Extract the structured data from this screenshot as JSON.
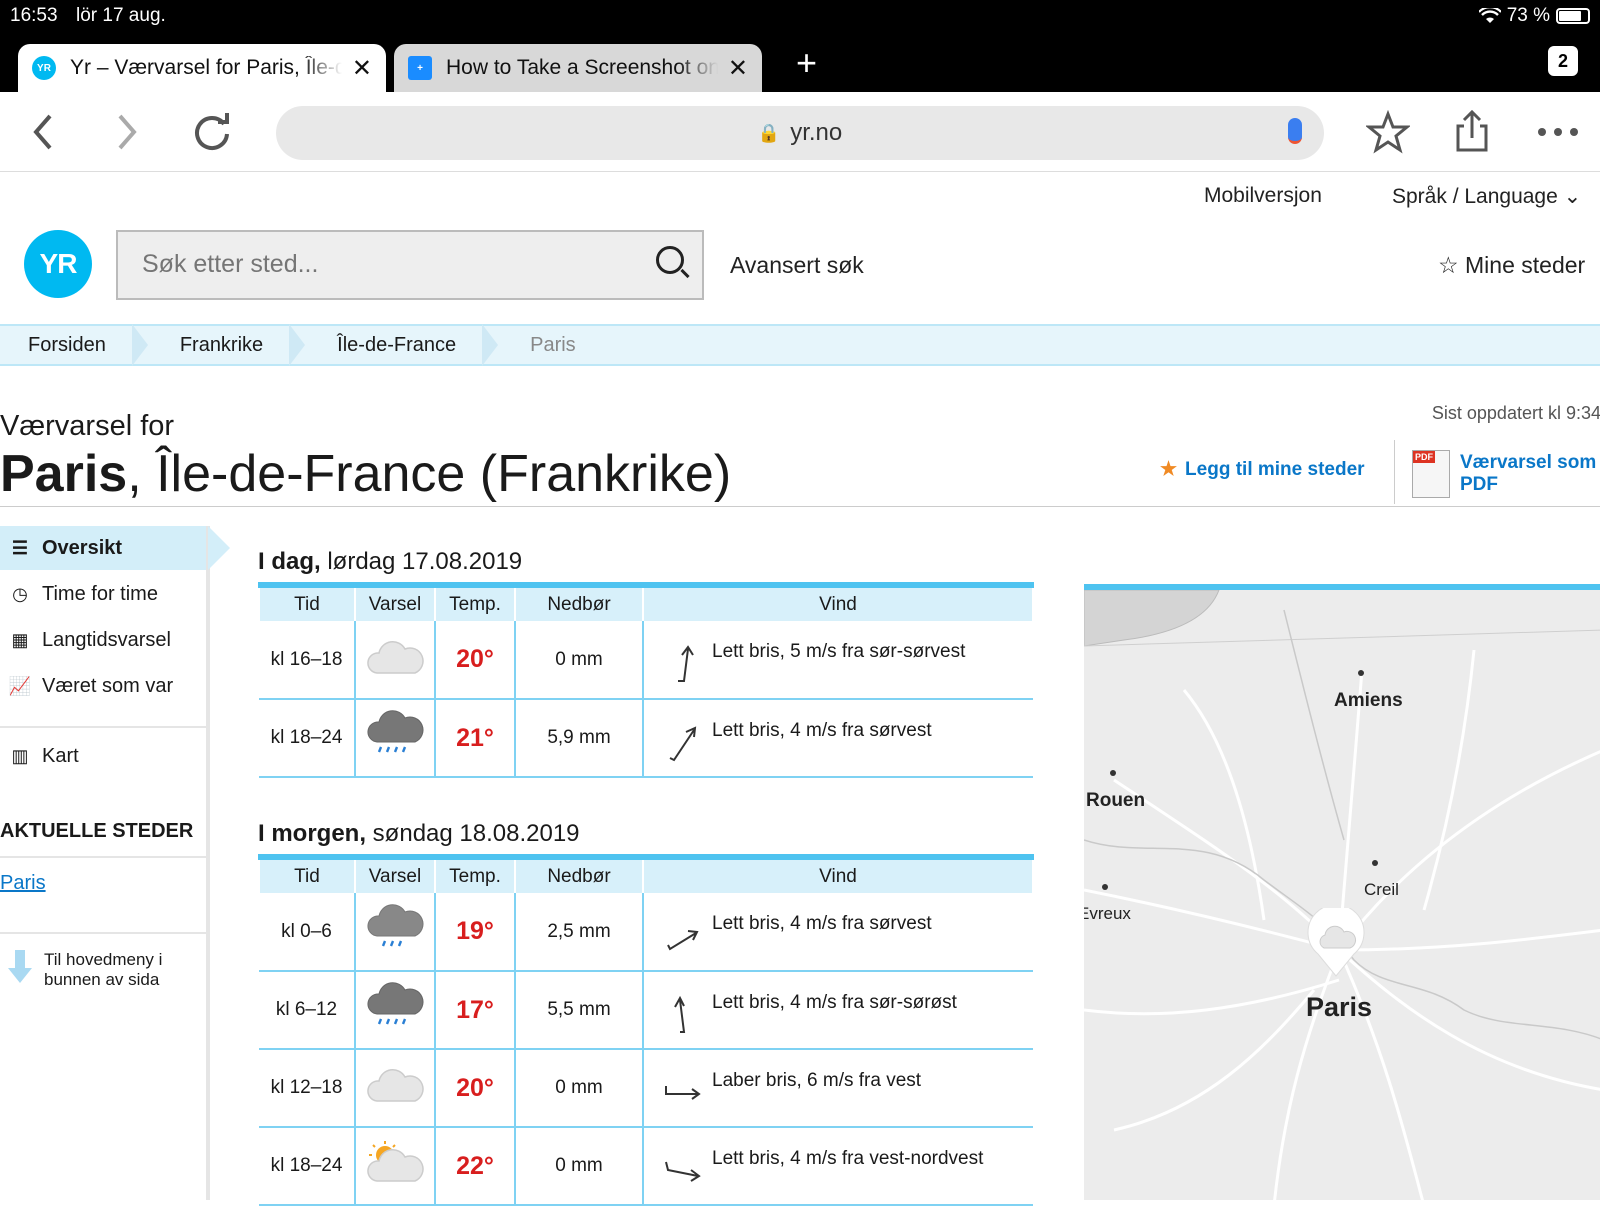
{
  "status": {
    "time": "16:53",
    "date": "lör 17 aug.",
    "battery": "73 %"
  },
  "tabs": [
    {
      "title": "Yr – Værvarsel for Paris, Île-de-France (Frankrike)",
      "favicon": "YR"
    },
    {
      "title": "How to Take a Screenshot on an iPad"
    }
  ],
  "tab_count": "2",
  "url": "yr.no",
  "topmenu": {
    "mobile": "Mobilversjon",
    "language": "Språk / Language"
  },
  "search": {
    "placeholder": "Søk etter sted..."
  },
  "advanced_search": "Avansert søk",
  "my_places": "Mine steder",
  "logo": "YR",
  "breadcrumbs": [
    "Forsiden",
    "Frankrike",
    "Île-de-France",
    "Paris"
  ],
  "forecast_for": "Værvarsel for",
  "place": {
    "name": "Paris",
    "rest": ", Île-de-France (Frankrike)"
  },
  "updated": "Sist oppdatert kl 9:34.",
  "add_favorite": "Legg til mine steder",
  "pdf": {
    "line1": "Værvarsel som",
    "line2": "PDF",
    "badge": "PDF"
  },
  "nav": [
    {
      "label": "Oversikt",
      "icon": "list-icon"
    },
    {
      "label": "Time for time",
      "icon": "clock-icon"
    },
    {
      "label": "Langtidsvarsel",
      "icon": "calendar-icon"
    },
    {
      "label": "Været som var",
      "icon": "chart-icon"
    },
    {
      "label": "Kart",
      "icon": "map-icon"
    }
  ],
  "aktuelle": "AKTUELLE STEDER",
  "aktuelle_link": "Paris",
  "to_menu": "Til hovedmeny i bunnen av sida",
  "columns": {
    "tid": "Tid",
    "varsel": "Varsel",
    "temp": "Temp.",
    "nedbor": "Nedbør",
    "vind": "Vind"
  },
  "days": [
    {
      "bold": "I dag,",
      "rest": " lørdag 17.08.2019",
      "rows": [
        {
          "time": "kl 16–18",
          "icon": "cloud",
          "temp": "20°",
          "precip": "0 mm",
          "wind": "Lett bris, 5 m/s fra sør-sørvest"
        },
        {
          "time": "kl 18–24",
          "icon": "rain",
          "temp": "21°",
          "precip": "5,9 mm",
          "wind": "Lett bris, 4 m/s fra sørvest"
        }
      ]
    },
    {
      "bold": "I morgen,",
      "rest": " søndag 18.08.2019",
      "rows": [
        {
          "time": "kl 0–6",
          "icon": "rain",
          "temp": "19°",
          "precip": "2,5 mm",
          "wind": "Lett bris, 4 m/s fra sørvest"
        },
        {
          "time": "kl 6–12",
          "icon": "rain",
          "temp": "17°",
          "precip": "5,5 mm",
          "wind": "Lett bris, 4 m/s fra sør-sørøst"
        },
        {
          "time": "kl 12–18",
          "icon": "cloud",
          "temp": "20°",
          "precip": "0 mm",
          "wind": "Laber bris, 6 m/s fra vest"
        },
        {
          "time": "kl 18–24",
          "icon": "sun-cloud",
          "temp": "22°",
          "precip": "0 mm",
          "wind": "Lett bris, 4 m/s fra vest-nordvest"
        }
      ]
    }
  ],
  "map": {
    "cities": [
      "Amiens",
      "Rouen",
      "Creil",
      "Evreux",
      "Paris"
    ]
  },
  "colors": {
    "accent": "#00b9f1",
    "temp": "#d81e1e",
    "link": "#0a77c8",
    "table_border": "#4ec3f0"
  }
}
